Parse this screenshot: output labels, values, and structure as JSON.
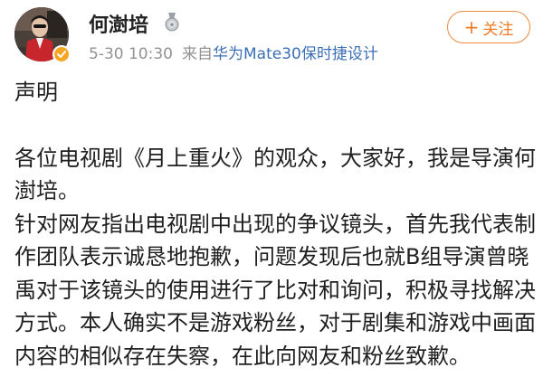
{
  "header": {
    "username": "何澍培",
    "time": "5-30 10:30",
    "source_prefix": "来自",
    "device": "华为Mate30保时捷设计",
    "follow_plus": "+",
    "follow_label": "关注",
    "medal_icon": "medal-icon",
    "verified_icon": "verified-badge-icon"
  },
  "post": {
    "title": "声明",
    "paragraphs": [
      "各位电视剧《月上重火》的观众，大家好，我是导演何澍培。",
      "针对网友指出电视剧中出现的争议镜头，首先我代表制作团队表示诚恳地抱歉，问题发现后也就B组导演曾晓禹对于该镜头的使用进行了比对和询问，积极寻找解决方式。本人确实不是游戏粉丝，对于剧集和游戏中画面内容的相似存在失察，在此向网友和粉丝致歉。"
    ]
  },
  "colors": {
    "accent": "#f07b22",
    "meta_text": "#939393",
    "device_link": "#3b6fb6",
    "body_text": "#1f1f1f"
  }
}
